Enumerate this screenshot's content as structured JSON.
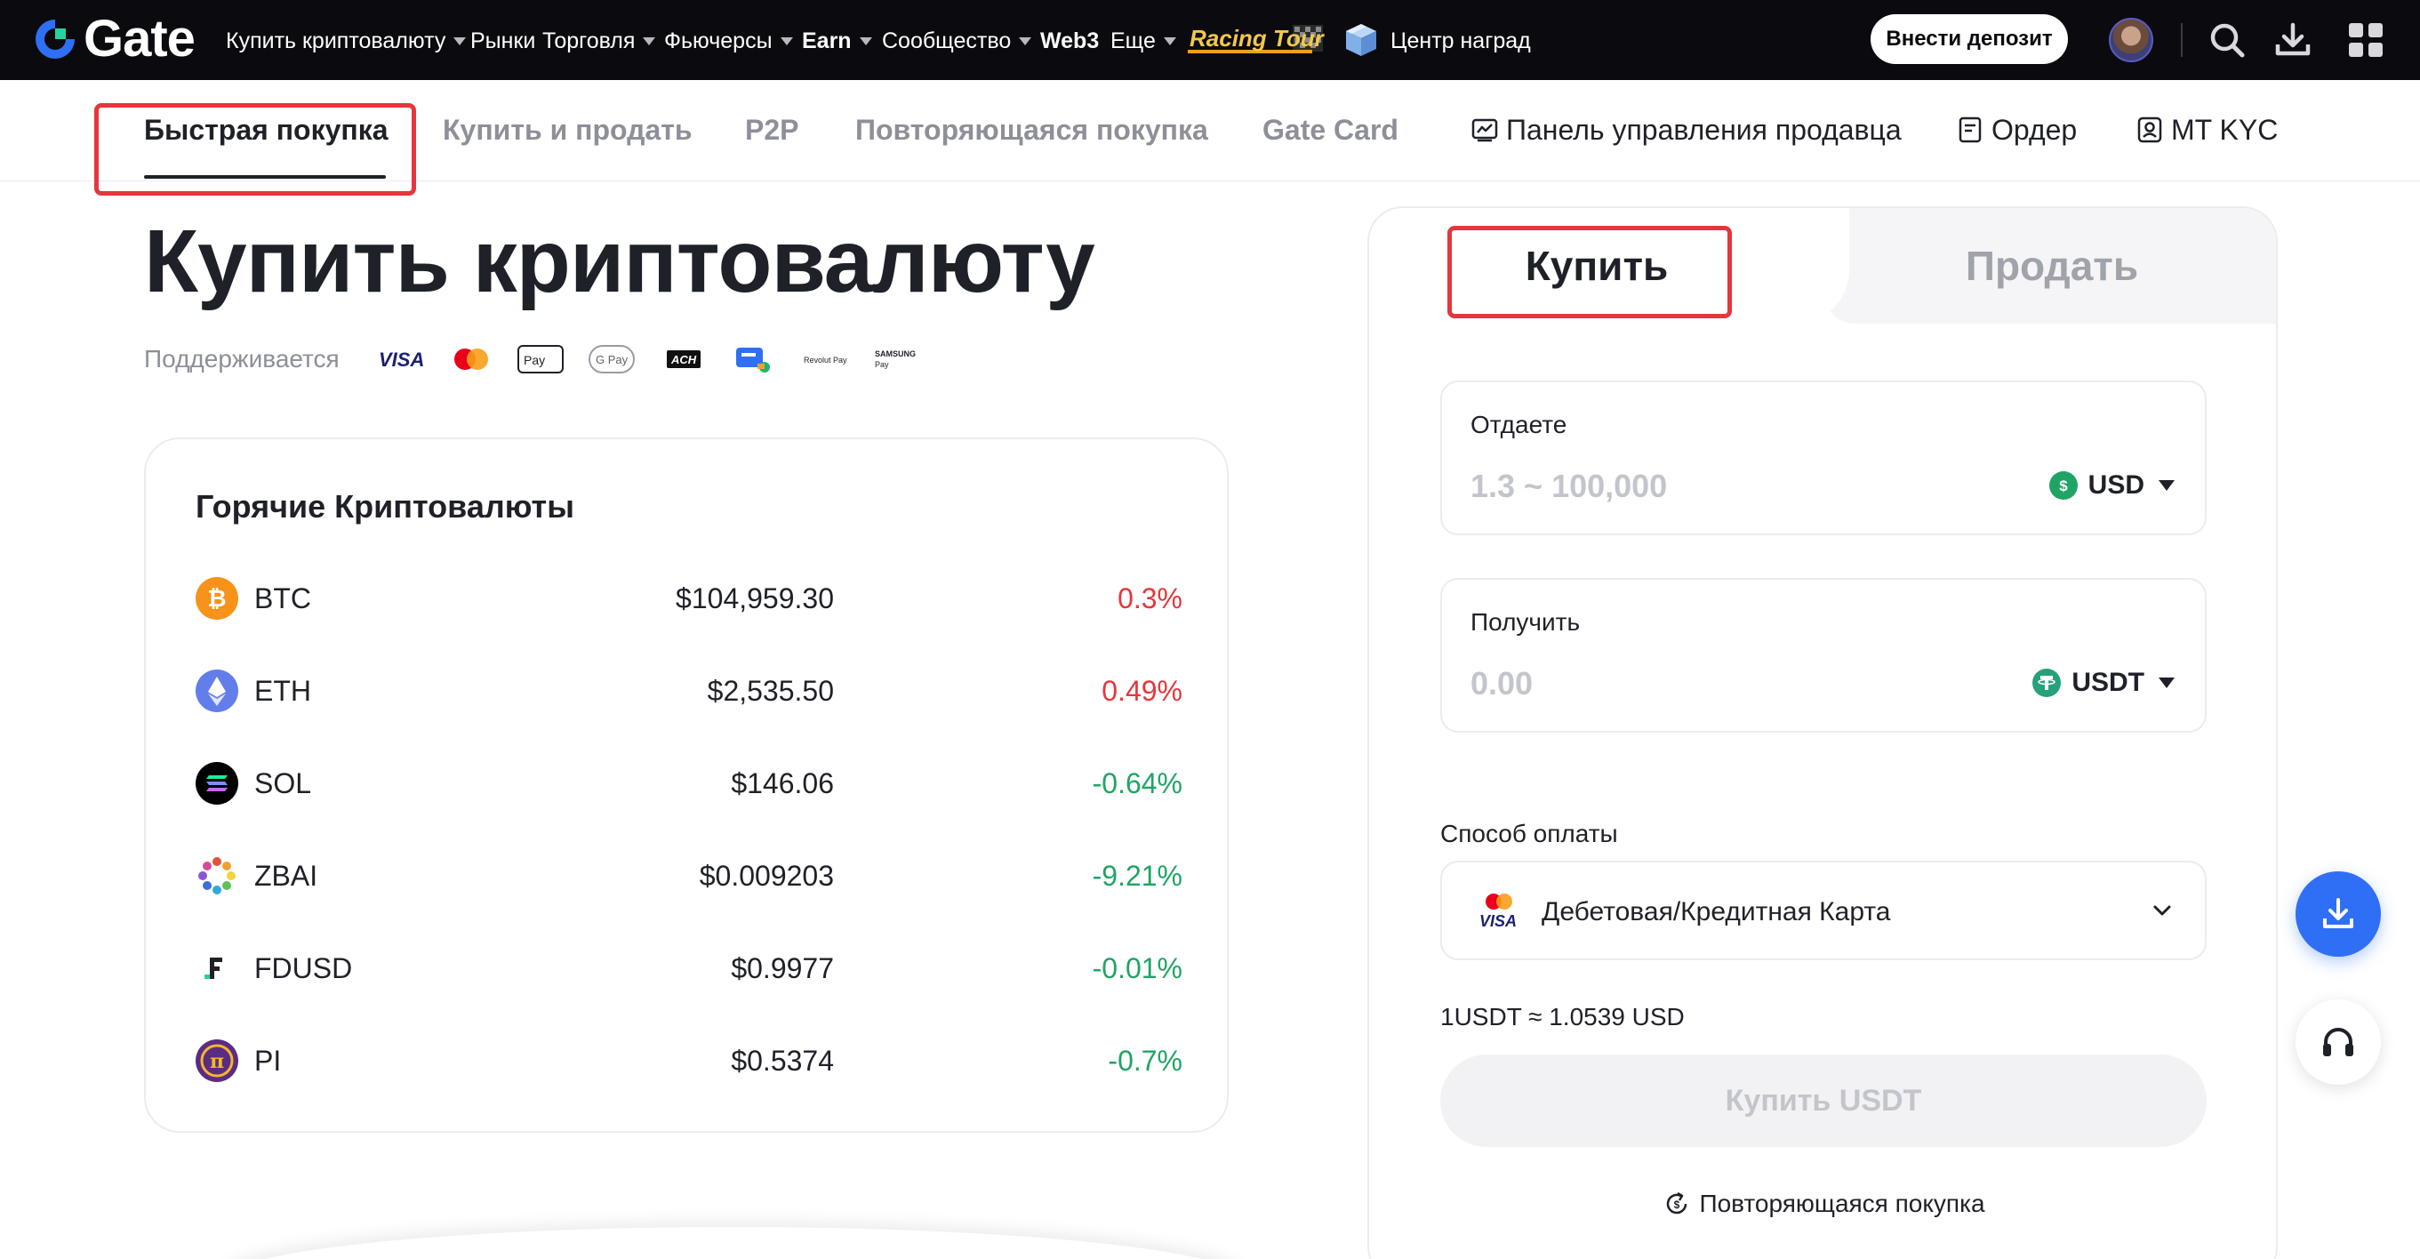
{
  "brand": {
    "name": "Gate",
    "accent": "#2f6ff5",
    "negative_color": "#e5363c",
    "positive_color": "#20a464"
  },
  "topnav": {
    "items": [
      {
        "label": "Купить криптовалюту",
        "dropdown": true
      },
      {
        "label": "Рынки",
        "dropdown": false
      },
      {
        "label": "Торговля",
        "dropdown": true
      },
      {
        "label": "Фьючерсы",
        "dropdown": true
      },
      {
        "label": "Earn",
        "dropdown": true
      },
      {
        "label": "Сообщество",
        "dropdown": true
      },
      {
        "label": "Web3",
        "dropdown": false
      },
      {
        "label": "Еще",
        "dropdown": true
      }
    ],
    "racing_tour": "Racing Tour",
    "rewards": "Центр наград",
    "deposit": "Внести депозит",
    "icons": [
      "search-icon",
      "download-icon",
      "apps-grid-icon"
    ]
  },
  "subnav": {
    "tabs": [
      {
        "label": "Быстрая покупка",
        "active": true
      },
      {
        "label": "Купить и продать"
      },
      {
        "label": "P2P"
      },
      {
        "label": "Повторяющаяся покупка"
      },
      {
        "label": "Gate Card"
      },
      {
        "label": "Панель управления продавца",
        "icon": "chart-board-icon"
      },
      {
        "label": "Ордер",
        "icon": "order-icon"
      },
      {
        "label": "MT KYC",
        "icon": "id-card-icon"
      }
    ]
  },
  "hero": {
    "title": "Купить криптовалюту",
    "supported_label": "Поддерживается",
    "payment_logos": [
      "VISA",
      "Mastercard",
      "Apple Pay",
      "G Pay",
      "ACH",
      "Wallet",
      "Revolut Pay",
      "SAMSUNG Pay"
    ]
  },
  "hot": {
    "title": "Горячие Криптовалюты",
    "coins": [
      {
        "symbol": "BTC",
        "price": "$104,959.30",
        "change": "0.3%",
        "direction": "up",
        "color": "#f7931a"
      },
      {
        "symbol": "ETH",
        "price": "$2,535.50",
        "change": "0.49%",
        "direction": "up",
        "color": "#627eea"
      },
      {
        "symbol": "SOL",
        "price": "$146.06",
        "change": "-0.64%",
        "direction": "down",
        "color": "#000000"
      },
      {
        "symbol": "ZBAI",
        "price": "$0.009203",
        "change": "-9.21%",
        "direction": "down",
        "color": "#e0523a"
      },
      {
        "symbol": "FDUSD",
        "price": "$0.9977",
        "change": "-0.01%",
        "direction": "down",
        "color": "#1f2128"
      },
      {
        "symbol": "PI",
        "price": "$0.5374",
        "change": "-0.7%",
        "direction": "down",
        "color": "#5b2c83"
      }
    ]
  },
  "trade": {
    "tab_buy": "Купить",
    "tab_sell": "Продать",
    "give": {
      "label": "Отдаете",
      "placeholder": "1.3 ~ 100,000",
      "currency": "USD"
    },
    "receive": {
      "label": "Получить",
      "placeholder": "0.00",
      "currency": "USDT"
    },
    "payment": {
      "label": "Способ оплаты",
      "method": "Дебетовая/Кредитная Карта",
      "card_brand": "VISA"
    },
    "rate": "1USDT ≈ 1.0539 USD",
    "buy_button": "Купить USDT",
    "recurring": "Повторяющаяся покупка"
  }
}
